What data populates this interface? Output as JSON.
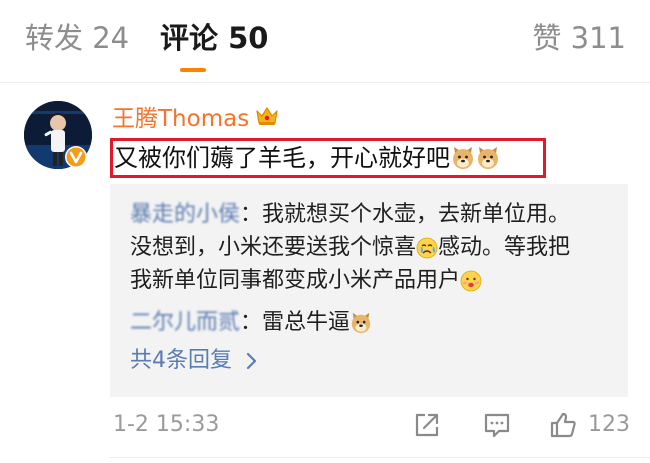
{
  "tabs": {
    "repost": "转发 24",
    "comment": "评论 50",
    "like": "赞 311"
  },
  "accent_color": "#ff8200",
  "highlight_color": "#e2182b",
  "comment": {
    "author": "王腾Thomas",
    "author_badge_icon": "crown-icon",
    "verified_badge_icon": "verified-v-icon",
    "text": "又被你们薅了羊毛，开心就好吧",
    "trailing_emojis": [
      "doge-emoji",
      "doge-emoji"
    ],
    "timestamp": "1-2 15:33",
    "like_count": "123"
  },
  "replies": [
    {
      "user": "暴走的小侯",
      "text_line1": "：我就想买个水壶，去新单位用。",
      "text_line2a": "没想到，小米还要送我个惊喜",
      "text_line2b": "感动。等我把",
      "text_line3": "我新单位同事都变成小米产品用户"
    },
    {
      "user": "二尔儿而贰",
      "text": "：雷总牛逼"
    }
  ],
  "more_replies_label": "共4条回复"
}
